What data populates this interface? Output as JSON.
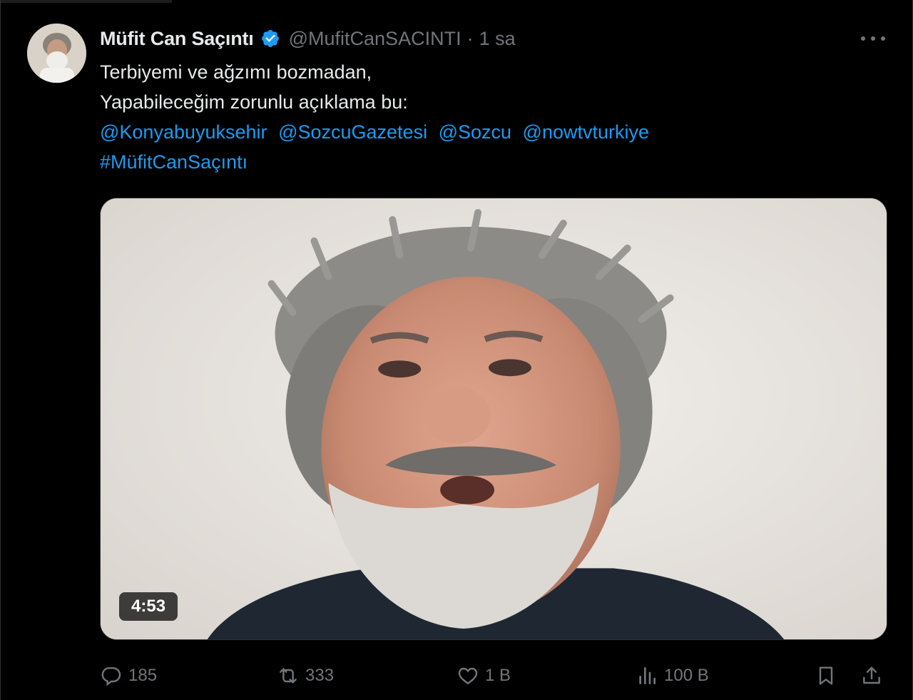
{
  "author": {
    "display_name": "Müfit Can Saçıntı",
    "handle": "@MufitCanSACINTI",
    "separator": "·",
    "time": "1 sa"
  },
  "tweet": {
    "line1": "Terbiyemi ve ağzımı bozmadan,",
    "line2": "Yapabileceğim zorunlu açıklama bu:",
    "mentions": [
      "@Konyabuyuksehir",
      "@SozcuGazetesi",
      "@Sozcu",
      "@nowtvturkiye"
    ],
    "hashtag": "#MüfitCanSaçıntı"
  },
  "media": {
    "duration": "4:53"
  },
  "actions": {
    "replies": "185",
    "retweets": "333",
    "likes": "1 B",
    "views": "100 B"
  },
  "icons": {
    "more": "more-dots-icon",
    "verified": "verified-badge-icon",
    "reply": "reply-icon",
    "retweet": "retweet-icon",
    "like": "heart-icon",
    "views": "views-chart-icon",
    "bookmark": "bookmark-icon",
    "share": "share-icon"
  },
  "colors": {
    "background": "#000000",
    "text": "#e7e9ea",
    "muted": "#71767b",
    "link": "#1d9bf0",
    "verified": "#1d9bf0"
  }
}
